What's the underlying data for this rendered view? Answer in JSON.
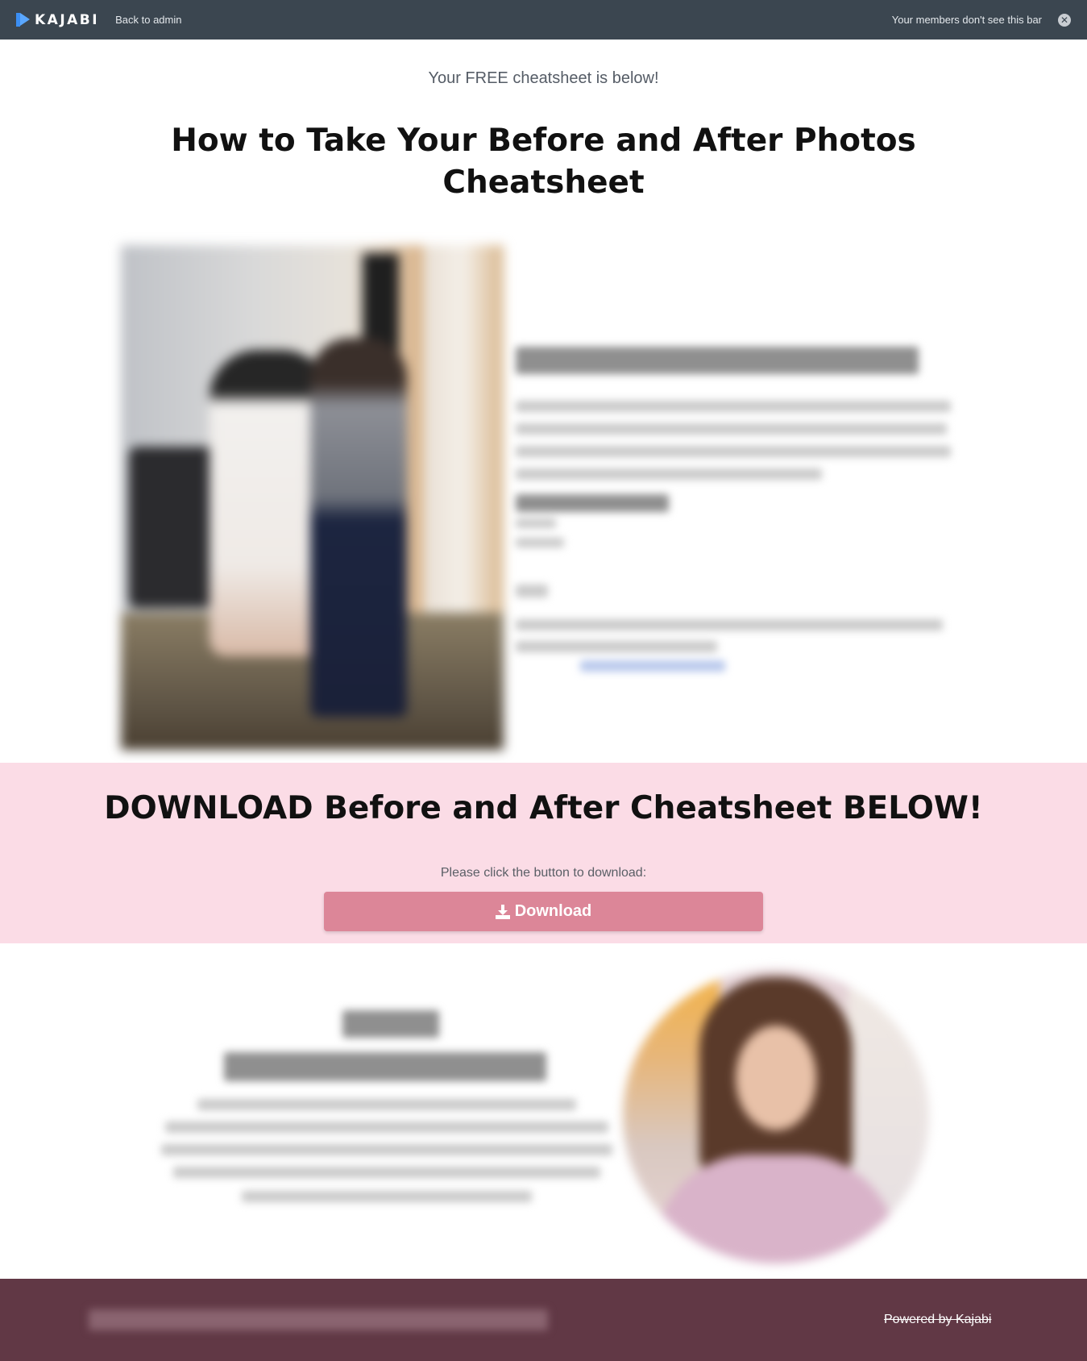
{
  "admin_bar": {
    "logo_text": "KAJABI",
    "back_label": "Back to admin",
    "members_note": "Your members don't see this bar",
    "close_symbol": "✕"
  },
  "hero": {
    "intro": "Your FREE cheatsheet is below!",
    "title": "How to Take Your Before and After Photos Cheatsheet"
  },
  "download": {
    "title": "DOWNLOAD Before and After Cheatsheet BELOW!",
    "subtitle": "Please click the button to download:",
    "button_label": "Download"
  },
  "footer": {
    "powered_by": "Powered by Kajabi"
  },
  "colors": {
    "admin_bar": "#3b4650",
    "accent_blue": "#3b8ef3",
    "pink_band": "#fbdce6",
    "button": "#dc8698",
    "footer": "#613845"
  }
}
